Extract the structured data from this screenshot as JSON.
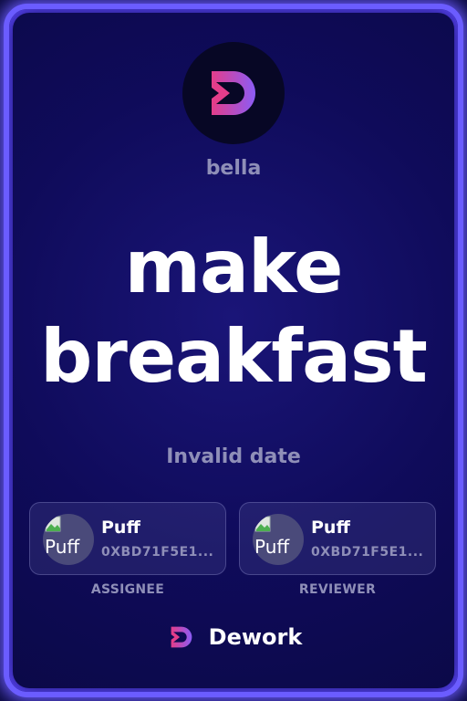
{
  "org": {
    "name": "bella"
  },
  "task": {
    "title_line1": "make",
    "title_line2": "breakfast",
    "date": "Invalid date"
  },
  "assignee": {
    "name": "Puff",
    "address": "0XBD71F5E1...",
    "avatar_alt": "Puff",
    "role": "ASSIGNEE"
  },
  "reviewer": {
    "name": "Puff",
    "address": "0XBD71F5E1...",
    "avatar_alt": "Puff",
    "role": "REVIEWER"
  },
  "footer": {
    "brand": "Dework"
  },
  "colors": {
    "accent": "#6b5cff",
    "logo_pink": "#e33d8a",
    "logo_purple": "#8b5cf6",
    "muted_text": "#8f8fb8"
  }
}
